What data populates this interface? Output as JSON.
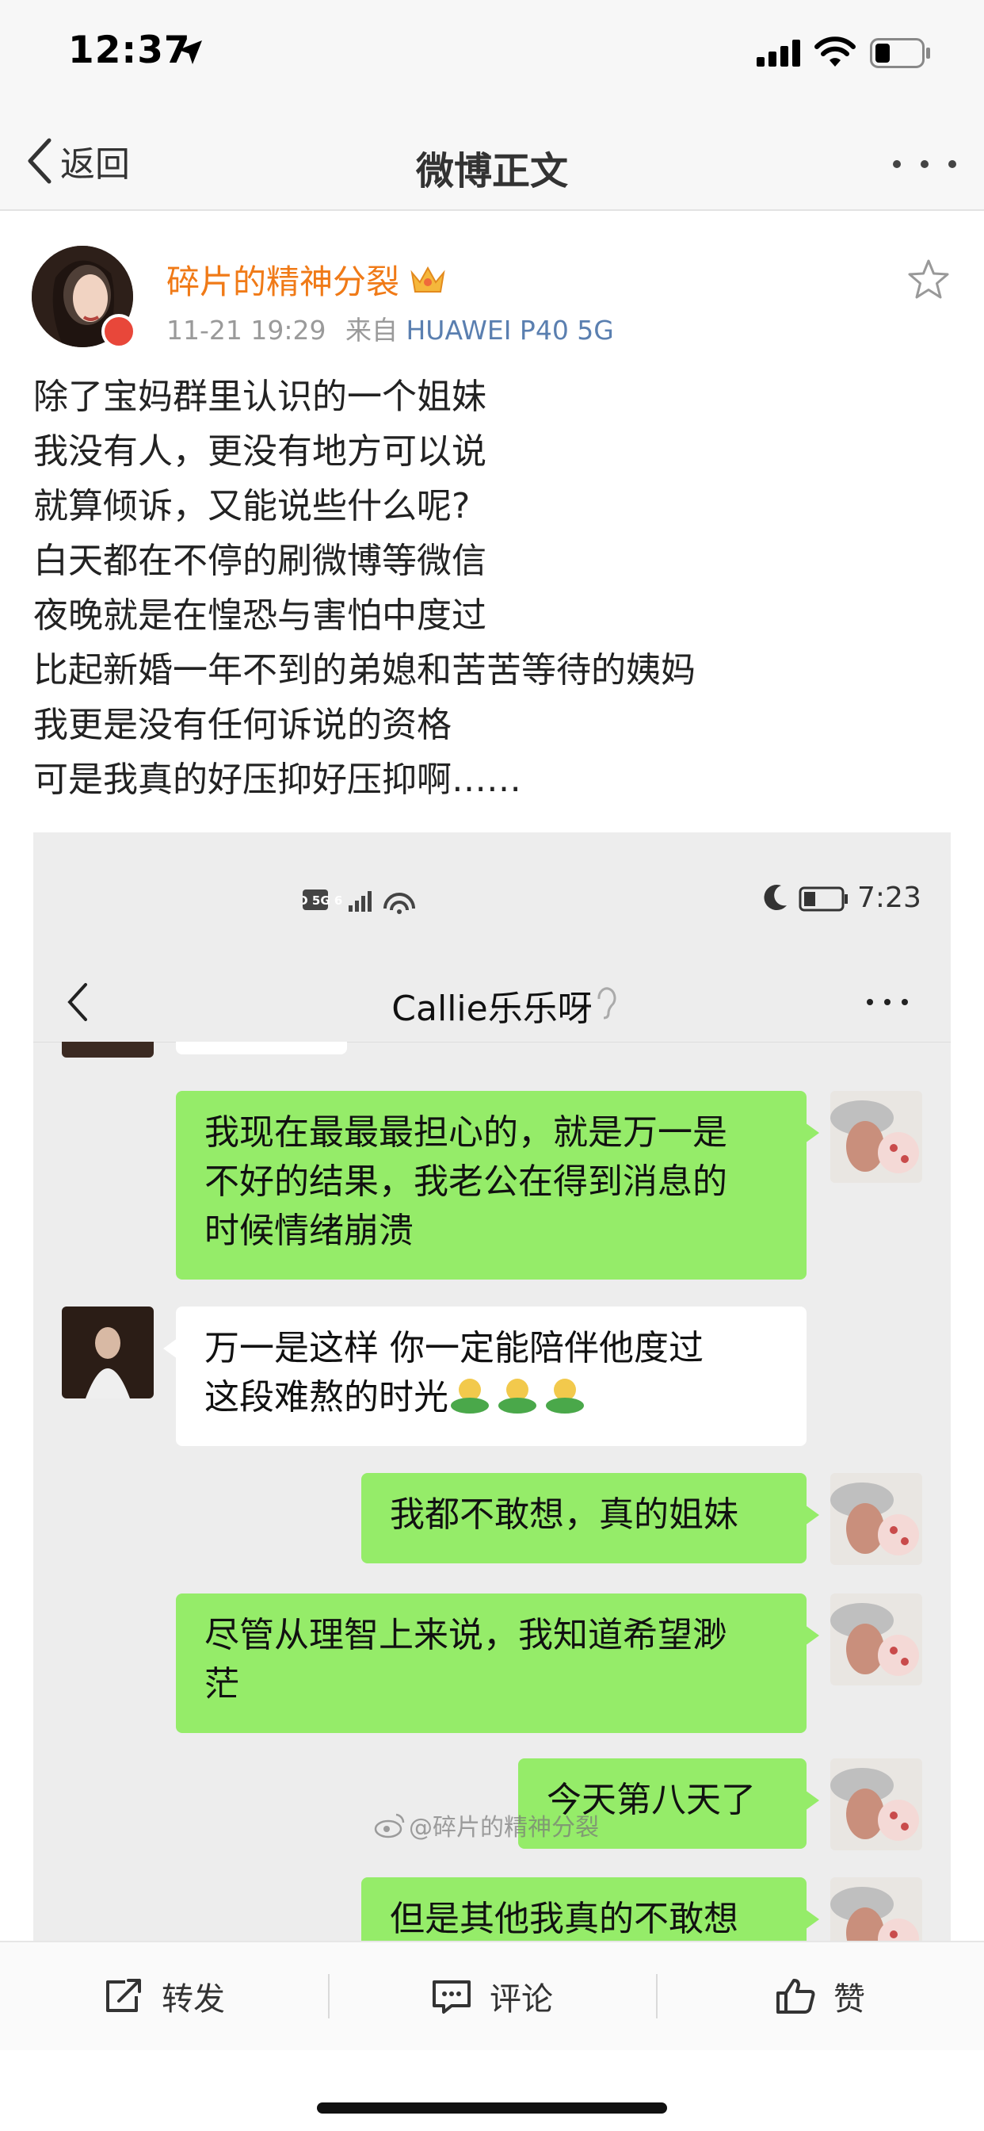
{
  "status_bar": {
    "time": "12:37"
  },
  "nav": {
    "back_label": "返回",
    "title": "微博正文"
  },
  "post": {
    "author": "碎片的精神分裂",
    "timestamp": "11-21 19:29",
    "source_prefix": "来自",
    "device": "HUAWEI P40 5G",
    "lines": [
      "除了宝妈群里认识的一个姐妹",
      "我没有人，更没有地方可以说",
      "就算倾诉，又能说些什么呢?",
      "白天都在不停的刷微博等微信",
      "夜晚就是在惶恐与害怕中度过",
      "比起新婚一年不到的弟媳和苦苦等待的姨妈",
      "我更是没有任何诉说的资格",
      "可是我真的好压抑好压抑啊……"
    ]
  },
  "image": {
    "status_time": "7:23",
    "status_icons_left": "HD 5G 6",
    "chat_title": "Callie乐乐呀",
    "messages": [
      {
        "from": "me",
        "lines": [
          "我现在最最最担心的，就是万一是",
          "不好的结果，我老公在得到消息的",
          "时候情绪崩溃"
        ]
      },
      {
        "from": "other",
        "lines": [
          "万一是这样 你一定能陪伴他度过",
          "这段难熬的时光"
        ]
      },
      {
        "from": "me",
        "lines": [
          "我都不敢想，真的姐妹"
        ]
      },
      {
        "from": "me",
        "lines": [
          "尽管从理智上来说，我知道希望渺",
          "茫"
        ]
      },
      {
        "from": "me",
        "lines": [
          "今天第八天了"
        ]
      },
      {
        "from": "me",
        "lines": [
          "但是其他我真的不敢想"
        ]
      }
    ],
    "watermark": "@碎片的精神分裂"
  },
  "actions": {
    "repost": "转发",
    "comment": "评论",
    "like": "赞"
  },
  "colors": {
    "author": "#f07a17",
    "device": "#5a7fb0",
    "bubble_me": "#95ec69",
    "bubble_other": "#ffffff"
  },
  "icons": [
    "location-arrow-icon",
    "signal-icon",
    "wifi-icon",
    "battery-icon",
    "back-chevron-icon",
    "more-icon",
    "crown-icon",
    "star-icon",
    "repost-icon",
    "comment-icon",
    "like-icon"
  ]
}
